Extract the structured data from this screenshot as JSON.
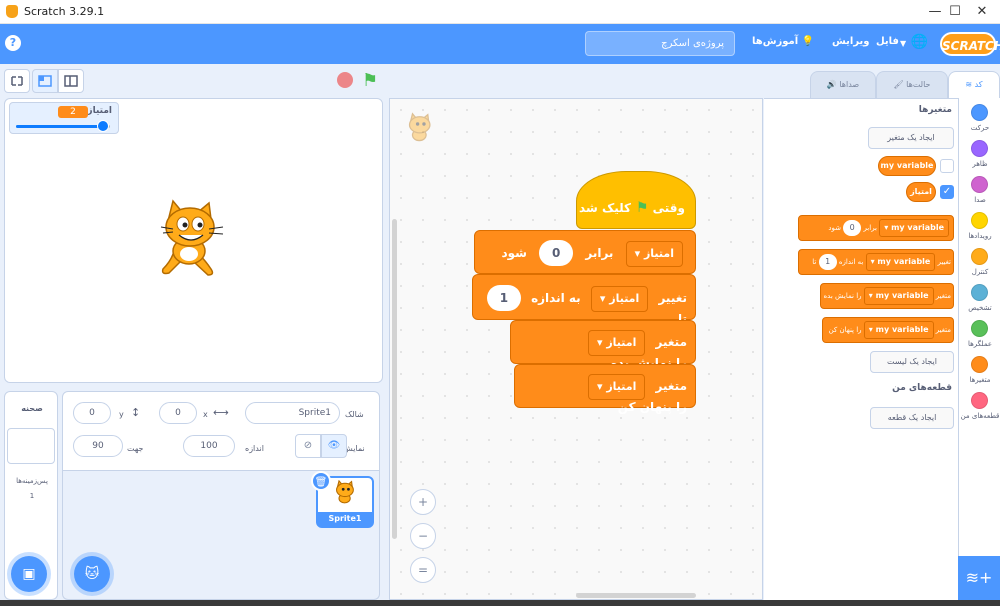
{
  "window": {
    "title": "Scratch 3.29.1",
    "minimize": "—",
    "maximize": "☐",
    "close": "✕"
  },
  "menubar": {
    "logo": "SCRATCH",
    "file": "فایل",
    "edit": "ویرایش",
    "tutorials": "آموزش‌ها",
    "project_title": "پروژه‌ی اسکرچ",
    "help": "?"
  },
  "tabs": {
    "code": "کد",
    "costumes": "حالت‌ها",
    "sounds": "صداها"
  },
  "stage": {
    "monitor_label": "امتیاز",
    "monitor_value": "2",
    "monitor_slider_fraction": 0.93
  },
  "sprite_info": {
    "sprite_label": "شالک",
    "sprite_name": "Sprite1",
    "x_label": "x",
    "x_value": "0",
    "y_label": "y",
    "y_value": "0",
    "show_label": "نمایش",
    "size_label": "اندازه",
    "size_value": "100",
    "direction_label": "جهت",
    "direction_value": "90"
  },
  "stage_pane": {
    "title": "صحنه",
    "backdrops_label": "پس‌زمینه‌ها",
    "backdrops_count": "1"
  },
  "sprite_list": [
    {
      "name": "Sprite1"
    }
  ],
  "script": {
    "hat": {
      "text_before": "وقتی",
      "text_after": "کلیک شد"
    },
    "blocks": [
      {
        "verb": "امتیاز",
        "middle": "برابر",
        "value": "0",
        "end": "شود"
      },
      {
        "verb": "تغییر",
        "dd": "امتیاز",
        "middle": "به اندازه",
        "value": "1",
        "end": "تا"
      },
      {
        "verb": "متغیر",
        "dd": "امتیاز",
        "end": "را نمایش بده"
      },
      {
        "verb": "متغیر",
        "dd": "امتیاز",
        "end": "را پنهان کن"
      }
    ]
  },
  "zoom": {
    "in": "+",
    "out": "−",
    "reset": "="
  },
  "palette": {
    "heading": "متغیرها",
    "make_variable": "ایجاد یک متغیر",
    "variables": [
      {
        "name": "my variable",
        "checked": false
      },
      {
        "name": "امتیاز",
        "checked": true
      }
    ],
    "set_block": {
      "verb": "",
      "dd": "my variable",
      "middle": "برابر",
      "value": "0",
      "end": "شود"
    },
    "change_block": {
      "verb": "تغییر",
      "dd": "my variable",
      "middle": "به اندازه",
      "value": "1",
      "end": "تا"
    },
    "show_block": {
      "verb": "متغیر",
      "dd": "my variable",
      "end": "را نمایش بده"
    },
    "hide_block": {
      "verb": "متغیر",
      "dd": "my variable",
      "end": "را پنهان کن"
    },
    "make_list": "ایجاد یک لیست",
    "my_blocks_heading": "قطعه‌های من",
    "make_block": "ایجاد یک قطعه"
  },
  "categories": [
    {
      "label": "حرکت",
      "color": "#4c97ff"
    },
    {
      "label": "ظاهر",
      "color": "#9966ff"
    },
    {
      "label": "صدا",
      "color": "#cf63cf"
    },
    {
      "label": "رویدادها",
      "color": "#ffd500"
    },
    {
      "label": "کنترل",
      "color": "#ffab19"
    },
    {
      "label": "تشخیص",
      "color": "#5cb1d6"
    },
    {
      "label": "عملگرها",
      "color": "#59c059"
    },
    {
      "label": "متغیرها",
      "color": "#ff8c1a"
    },
    {
      "label": "قطعه‌های من",
      "color": "#ff6680"
    }
  ]
}
